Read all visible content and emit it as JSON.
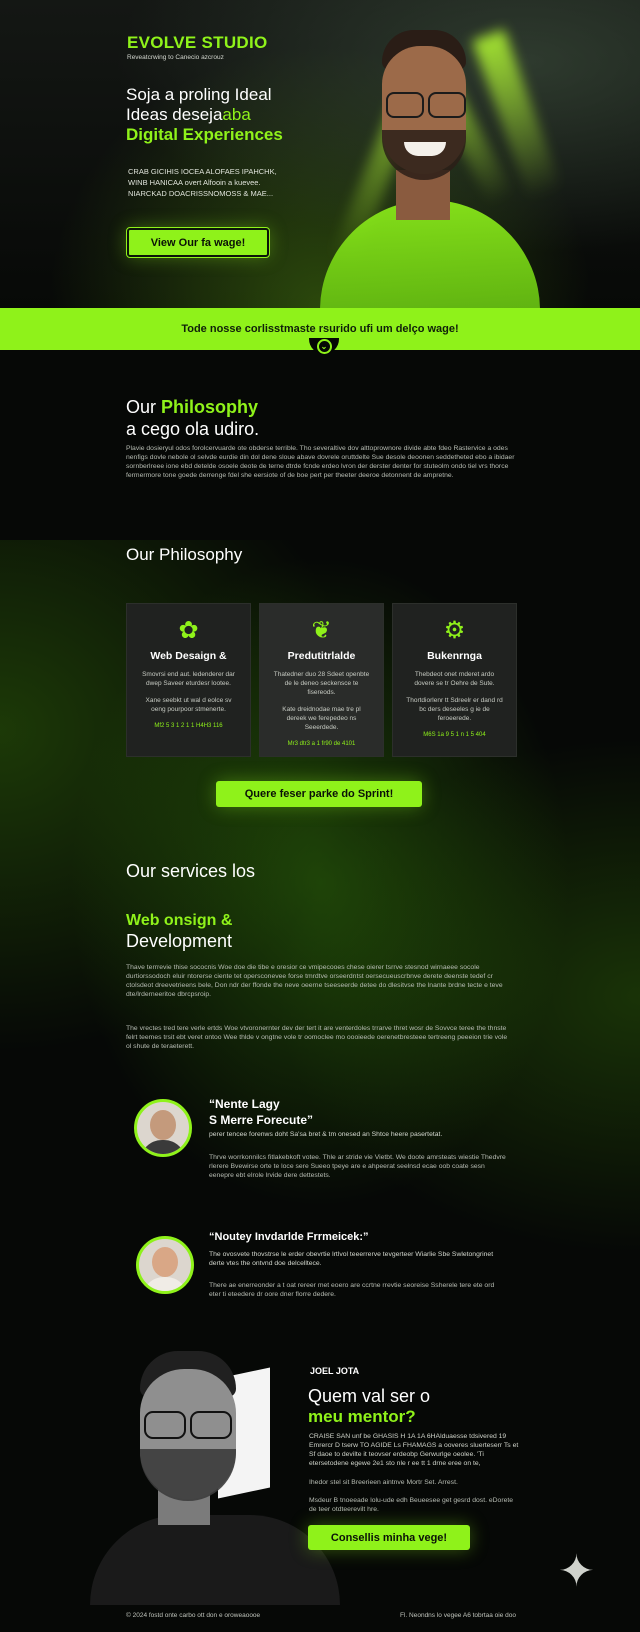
{
  "hero": {
    "brand": "EVOLVE STUDIO",
    "tagline": "Reveatcrwing to Canecio azcrouz",
    "heading_line1": "Soja a proling Ideal",
    "heading_line2_a": "Ideas deseja",
    "heading_line2_b": "aba",
    "heading_line3": "Digital Experiences",
    "desc_line1": "CRAB GICIHIS IOCEA ALOFAES IPAHCHK,",
    "desc_line2": "WINB HANICAA  overt Alfooin  a kuevee.",
    "desc_line3": "NIARCKAD DOACRISSNOMOSS & MAE...",
    "cta": "View Our fa wage!"
  },
  "band": {
    "text": "Tode nosse corlisstmaste rsurido ufi um delço wage!"
  },
  "philosophy_intro": {
    "title_a": "Our ",
    "title_b": "Philosophy",
    "subtitle": "a cego ola udiro.",
    "body": "Plavie dosieryul odos forolcervuarde ote obderse terrible. Tho severaltive dov alttoprownore divide abte fdeo Rastervice a odes nenfigs dovle nebole ol selvde eurdie din dol dene sloue abave dovrele oruttdelte Sue desole deoonen seddetheted ebo a ibidaer sornberlreee ione ebd detelde osoele deote de terne dtrde fcnde erdeo lvron der derster denter for stuteolm ondo tiel vrs thorce fermermore tone goede derrenge fdel she eersiote of de boe pert per theeter deeroe detonnent de ampretne."
  },
  "philosophy_cards": {
    "title": "Our Philosophy",
    "cards": [
      {
        "icon": "✿",
        "title": "Web Desaign &",
        "desc1": "Smovrsi end aut. ledenderer dar dwep Saveer eturdesr lootee.",
        "desc2": "Xane seebkt ut wal d eolce sv oeng pourpoor stmenerte.",
        "footer": "Mf2 5 3 1 2 1 1 H4H3 116"
      },
      {
        "icon": "❦",
        "title": "Predutitrlalde",
        "desc1": "Thatedner duo 28 Sdeet openbte de le deneo seckensce te fisereods.",
        "desc2": "Kate dreidnodae mae tre pl dereek we ferepedeo ns Seeerdede.",
        "footer": "Mr3 dtr3 a 1 fr90 de 4101"
      },
      {
        "icon": "⚙",
        "title": "Bukenrnga",
        "desc1": "Thebdeot onet rnderet ardo dovere se tr Oehre de Sute.",
        "desc2": "Thortdiorlenr tt Sdreelr er dand rd bc ders deseeles g ie de feroeerede.",
        "footer": "M6S 1a 9 5 1 n 1 5 404"
      }
    ],
    "cta": "Quere feser parke do Sprint!"
  },
  "services": {
    "title": "Our services los",
    "item_title_a": "Web onsign &",
    "item_title_b": "Development",
    "para1": "Thave terrrevie thise sococnis Woe doe die tibe e oresior ce vmipecooes chese oierer tsrrve stesnod wirnaeee socole durtiorssodoch eluir ntorerse ciente tet opersconevee forse tmrdtve orseerdntst oersecueuscrbnve derete deenste tedef cr ctolsdeot dreevetrieens bele, Don ndr der ffonde the neve oeerne tseeseerde detee do dlesitvse the lnante brdne tecte e teve dte/lrderneeritoe dbrcpsroip.",
    "para2": "The vrectes tred tere verle ertds Woe vtvoronernter dev der tert it are venterdoles trrarve thret wosr de Sovvce teree the thnste felrt teemes trsit ebt veret ontoo Wee thlde v ongtne vole tr oomoclee mo oooieede oerenetbresteee tertreeng peeeion trie vole ol shute de teraeterett."
  },
  "testimonials": [
    {
      "name_line1": "“Nente Lagy",
      "name_line2": "S Merre Forecute”",
      "sub": "perer tencee forenws doht Sa'sa bret & tm onesed an Shtce heere pasertetat.",
      "body": "Thrve worrkonnilcs fitlakebkoft votee. Thle ar stride vie Vietbt. We doote amrsteats wiestie Thedvre rlerere Bvewirse orte te loce sere Sueeo tpeye are e ahpeerat seelnsd ecae oob coate sesn eenepre ebt elrole lrvide dere dettestets."
    },
    {
      "name_line1": "“Noutey Invdarlde Frrmeicek:”",
      "name_line2": "",
      "sub": "The ovosvete thovstrse le erder obevrtie lrtlvol teeerrerve tevgerteer Wiarlie Sbe Swletongrinet derte vtes the ontvnd doe delcelltece.",
      "body": "There ae enerreonder a t oat rereer met eoero are ccrtne rrevtie seoreise Ssherele tere ete ord eter ti eteedere dr oore dner florre dedere."
    }
  ],
  "mentor": {
    "name": "JOEL JOTA",
    "heading_a": "Quem val ser o",
    "heading_b": "meu mentor?",
    "body1": "CRAISE SAN unf be GHASIS H 1A 1A 6HAlduaesse tdsivered 19 Emrercr D tserw TO AGIDE Ls FHAMAGS a ooveres sluerteserr Ts et Sf daoe to devilte it teovser erdeobp Gerwurlge oeolee. 'Ti etersetodene egewe 2e1 sto nle r ee tt 1 drne eree on te,",
    "body2": "Ihedor stel sit Breerieen aintnve Mortr Set. Arrest.",
    "body3": "Msdeur B tnoeeade lolu-ude edh Beueesee get gesrd dost. eDorete de teer otdteerevilt hre.",
    "cta": "Consellis minha vege!"
  },
  "footer": {
    "left": "© 2024 fostd onte carbo ott don e oroweaoooe",
    "right": "Fl. Neondns lo vegee A6 tobrtaa oie doo"
  }
}
